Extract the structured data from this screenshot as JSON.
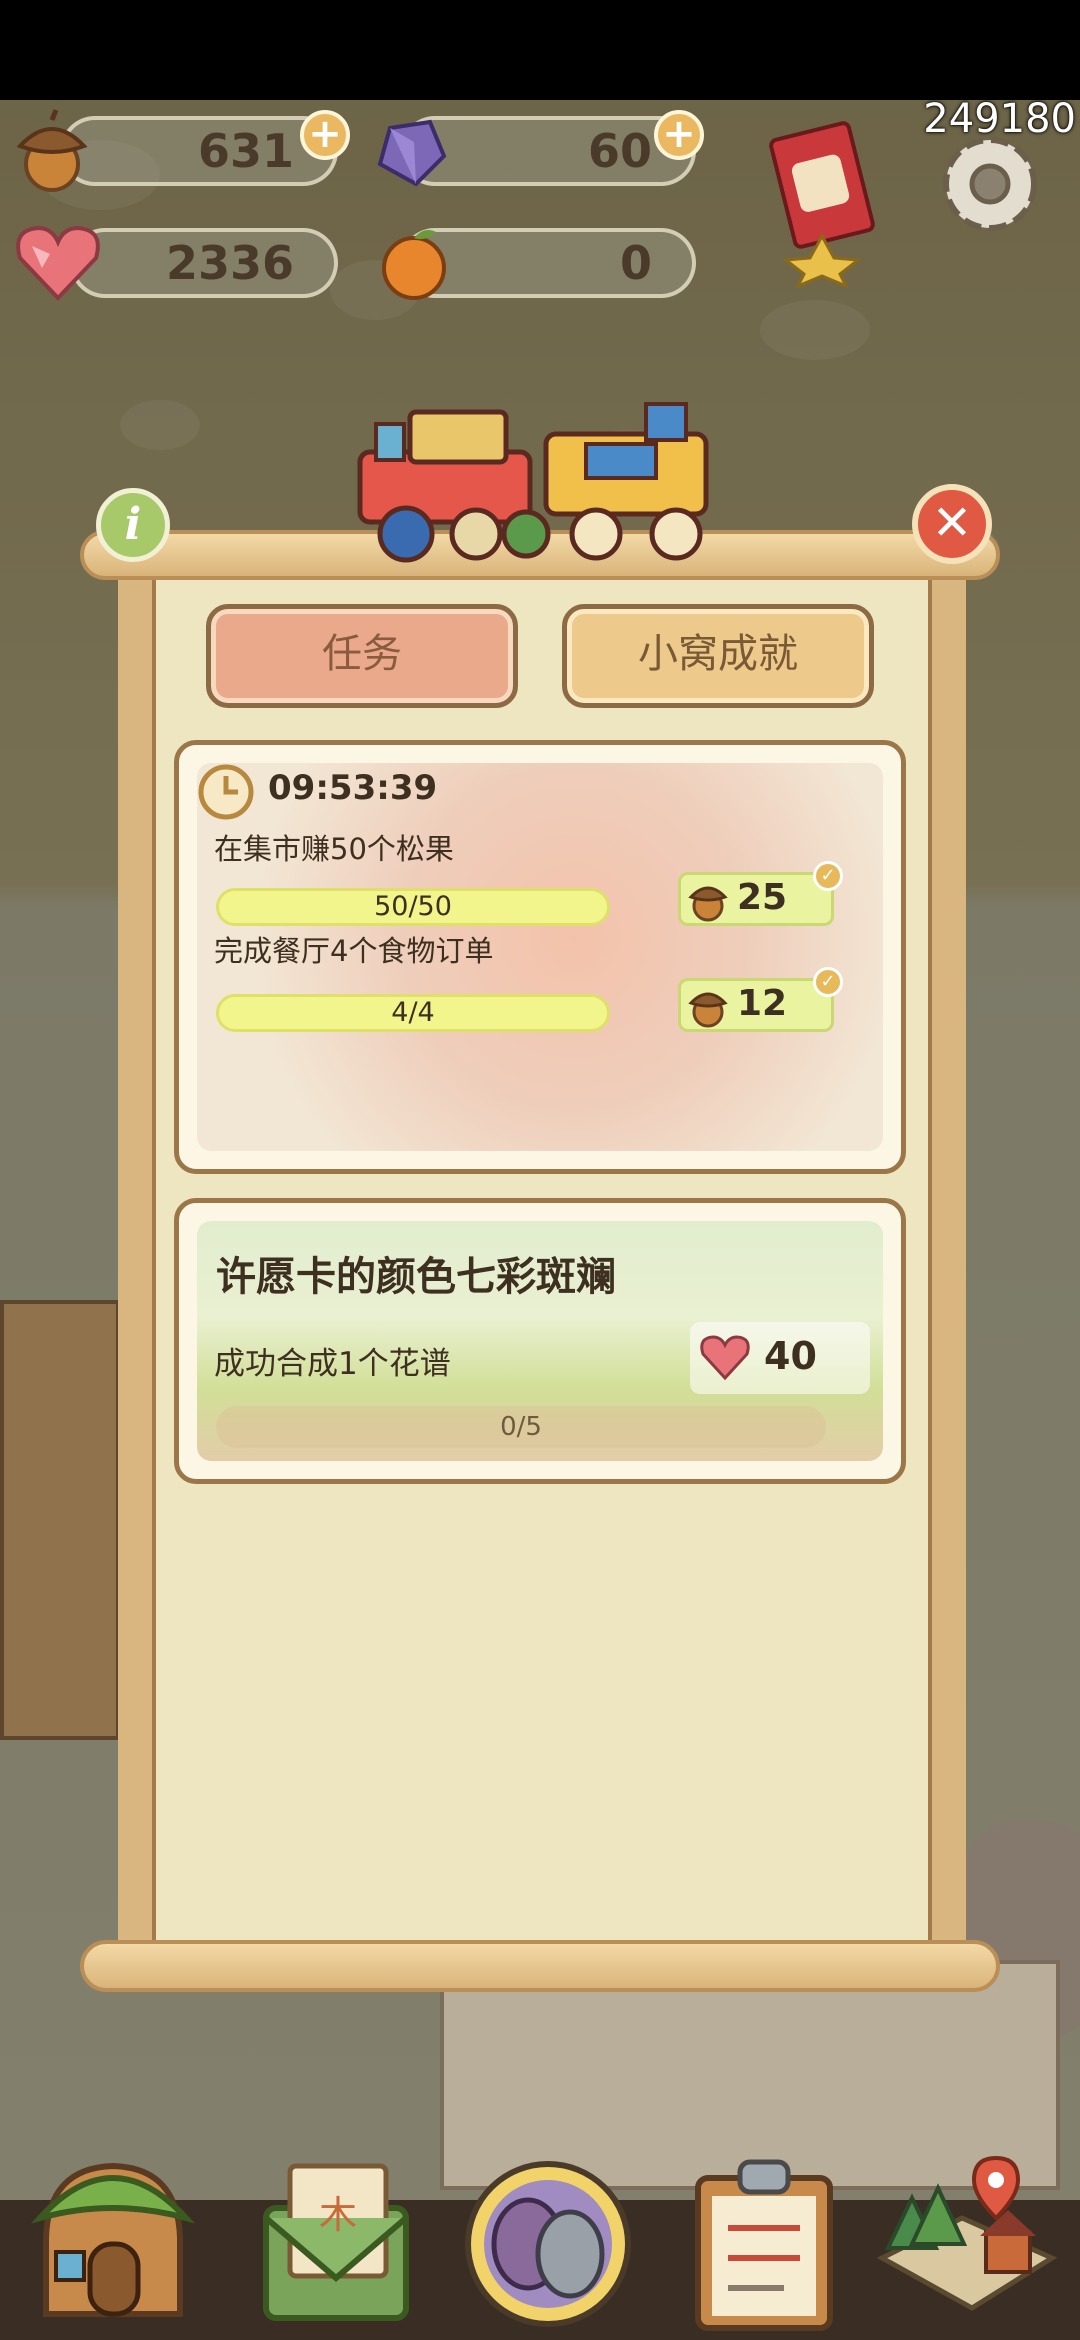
{
  "hud": {
    "acorns": "631",
    "crystals": "60",
    "hearts": "2336",
    "oranges": "0",
    "counter": "249180"
  },
  "tabs": {
    "tasks": "任务",
    "achievements": "小窝成就"
  },
  "daily": {
    "timer": "09:53:39",
    "tasks": [
      {
        "text": "在集市赚50个松果",
        "progress": "50/50",
        "reward": "25"
      },
      {
        "text": "完成餐厅4个食物订单",
        "progress": "4/4",
        "reward": "12"
      }
    ]
  },
  "special": {
    "title": "许愿卡的颜色七彩斑斓",
    "task": "成功合成1个花谱",
    "progress": "0/5",
    "reward": "40"
  },
  "colors": {
    "accent": "#e9a98a",
    "paper": "#eee6c0",
    "progress_fill": "#f2f58c",
    "close": "#e05a43",
    "info": "#a8c96a"
  },
  "icons": [
    "acorn-icon",
    "crystal-icon",
    "heart-gem-icon",
    "orange-icon",
    "gear-icon",
    "card-pack-icon",
    "info-icon",
    "close-icon",
    "clock-icon",
    "house-nav-icon",
    "mail-nav-icon",
    "gacha-nav-icon",
    "clipboard-nav-icon",
    "map-nav-icon"
  ]
}
